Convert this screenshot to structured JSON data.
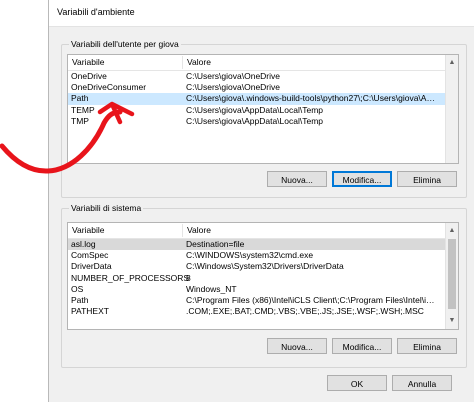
{
  "window": {
    "title": "Variabili d'ambiente"
  },
  "user_vars": {
    "group_label": "Variabili dell'utente per giova",
    "headers": {
      "name": "Variabile",
      "value": "Valore"
    },
    "rows": [
      {
        "name": "OneDrive",
        "value": "C:\\Users\\giova\\OneDrive"
      },
      {
        "name": "OneDriveConsumer",
        "value": "C:\\Users\\giova\\OneDrive"
      },
      {
        "name": "Path",
        "value": "C:\\Users\\giova\\.windows-build-tools\\python27\\;C:\\Users\\giova\\Ap..."
      },
      {
        "name": "TEMP",
        "value": "C:\\Users\\giova\\AppData\\Local\\Temp"
      },
      {
        "name": "TMP",
        "value": "C:\\Users\\giova\\AppData\\Local\\Temp"
      }
    ],
    "buttons": {
      "new": "Nuova...",
      "edit": "Modifica...",
      "delete": "Elimina"
    }
  },
  "system_vars": {
    "group_label": "Variabili di sistema",
    "headers": {
      "name": "Variabile",
      "value": "Valore"
    },
    "rows": [
      {
        "name": "asl.log",
        "value": "Destination=file"
      },
      {
        "name": "ComSpec",
        "value": "C:\\WINDOWS\\system32\\cmd.exe"
      },
      {
        "name": "DriverData",
        "value": "C:\\Windows\\System32\\Drivers\\DriverData"
      },
      {
        "name": "NUMBER_OF_PROCESSORS",
        "value": "8"
      },
      {
        "name": "OS",
        "value": "Windows_NT"
      },
      {
        "name": "Path",
        "value": "C:\\Program Files (x86)\\Intel\\iCLS Client\\;C:\\Program Files\\Intel\\iCL..."
      },
      {
        "name": "PATHEXT",
        "value": ".COM;.EXE;.BAT;.CMD;.VBS;.VBE;.JS;.JSE;.WSF;.WSH;.MSC"
      }
    ],
    "buttons": {
      "new": "Nuova...",
      "edit": "Modifica...",
      "delete": "Elimina"
    }
  },
  "footer": {
    "ok": "OK",
    "cancel": "Annulla"
  },
  "annotation": {
    "color": "#e8141b"
  }
}
